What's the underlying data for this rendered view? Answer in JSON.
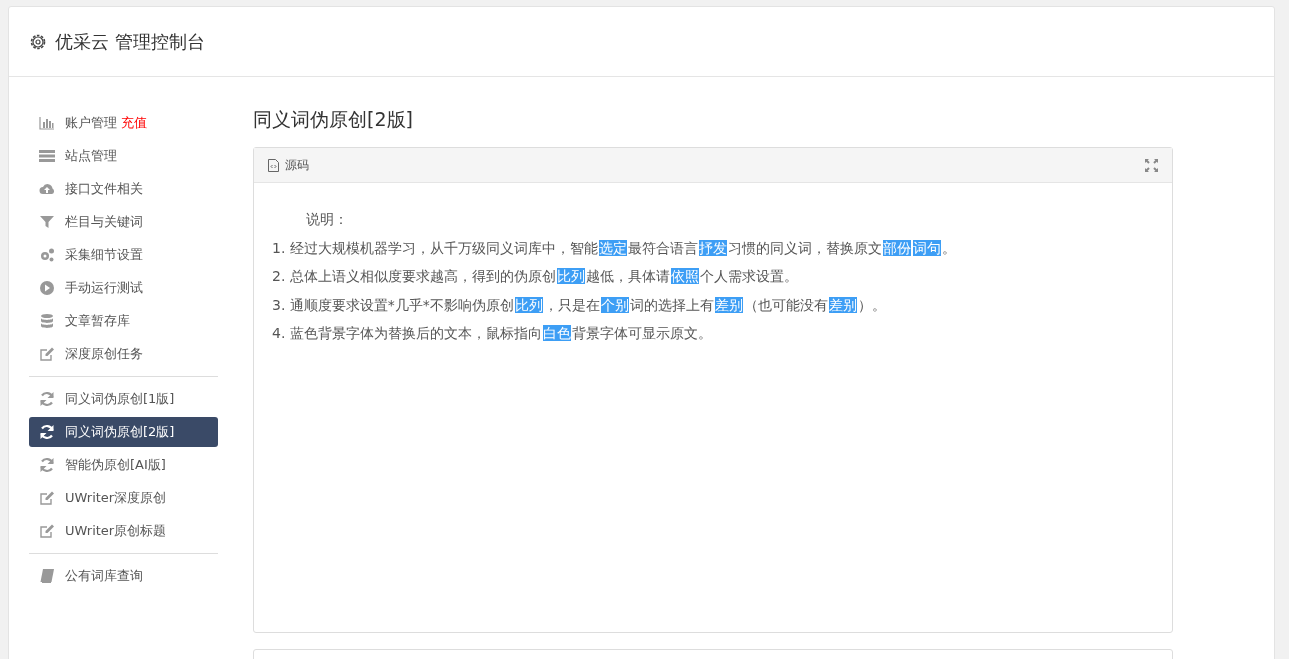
{
  "header": {
    "title": "优采云 管理控制台"
  },
  "sidebar": {
    "groups": [
      {
        "items": [
          {
            "kind": "bar-chart",
            "label": "账户管理",
            "badge": "充值",
            "selected": false
          },
          {
            "kind": "server",
            "label": "站点管理",
            "selected": false
          },
          {
            "kind": "cloud-upload",
            "label": "接口文件相关",
            "selected": false
          },
          {
            "kind": "filter",
            "label": "栏目与关键词",
            "selected": false
          },
          {
            "kind": "gears",
            "label": "采集细节设置",
            "selected": false
          },
          {
            "kind": "play",
            "label": "手动运行测试",
            "selected": false
          },
          {
            "kind": "database",
            "label": "文章暂存库",
            "selected": false
          },
          {
            "kind": "edit",
            "label": "深度原创任务",
            "selected": false
          }
        ]
      },
      {
        "items": [
          {
            "kind": "refresh",
            "label": "同义词伪原创[1版]",
            "selected": false
          },
          {
            "kind": "refresh",
            "label": "同义词伪原创[2版]",
            "selected": true
          },
          {
            "kind": "refresh",
            "label": "智能伪原创[AI版]",
            "selected": false
          },
          {
            "kind": "edit",
            "label": "UWriter深度原创",
            "selected": false
          },
          {
            "kind": "edit",
            "label": "UWriter原创标题",
            "selected": false
          }
        ]
      },
      {
        "items": [
          {
            "kind": "book",
            "label": "公有词库查询",
            "selected": false
          }
        ]
      }
    ]
  },
  "main": {
    "title": "同义词伪原创[2版]",
    "panel": {
      "tab": "源码",
      "heading": "说明：",
      "lines": [
        [
          {
            "text": "1. 经过大规模机器学习，从千万级同义词库中，智能",
            "highlight": false
          },
          {
            "text": "选定",
            "highlight": true
          },
          {
            "text": "最符合语言",
            "highlight": false
          },
          {
            "text": "抒发",
            "highlight": true
          },
          {
            "text": "习惯的同义词，替换原文",
            "highlight": false
          },
          {
            "text": "部份",
            "highlight": true
          },
          {
            "text": "词句",
            "highlight": true
          },
          {
            "text": "。",
            "highlight": false
          }
        ],
        [
          {
            "text": "2. 总体上语义相似度要求越高，得到的伪原创",
            "highlight": false
          },
          {
            "text": "比列",
            "highlight": true
          },
          {
            "text": "越低，具体请",
            "highlight": false
          },
          {
            "text": "依照",
            "highlight": true
          },
          {
            "text": "个人需求设置。",
            "highlight": false
          }
        ],
        [
          {
            "text": "3. 通顺度要求设置*几乎*不影响伪原创",
            "highlight": false
          },
          {
            "text": "比列",
            "highlight": true
          },
          {
            "text": "，只是在",
            "highlight": false
          },
          {
            "text": "个别",
            "highlight": true
          },
          {
            "text": "词的选择上有",
            "highlight": false
          },
          {
            "text": "差别",
            "highlight": true
          },
          {
            "text": "（也可能没有",
            "highlight": false
          },
          {
            "text": "差别",
            "highlight": true
          },
          {
            "text": "）。",
            "highlight": false
          }
        ],
        [
          {
            "text": "4. 蓝色背景字体为替换后的文本，鼠标指向",
            "highlight": false
          },
          {
            "text": "白色",
            "highlight": true
          },
          {
            "text": "背景字体可显示原文。",
            "highlight": false
          }
        ]
      ]
    }
  }
}
